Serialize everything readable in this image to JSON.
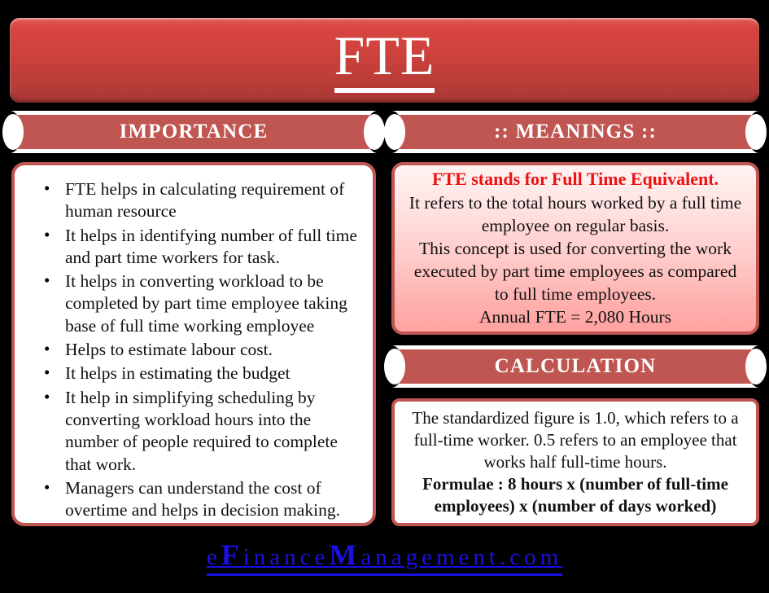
{
  "title": {
    "text": "FTE"
  },
  "sections": {
    "importance": {
      "ribbon_label": "IMPORTANCE",
      "bullets": [
        "FTE helps in calculating requirement of human resource",
        "It helps in identifying number of full time and part time workers for task.",
        "It helps in converting workload to be completed by part time employee taking base of full time working employee",
        "Helps to estimate labour cost.",
        "It helps in estimating the budget",
        "It help in simplifying scheduling by converting workload hours into the number of people required to complete that work.",
        "Managers can understand the cost of overtime and helps in decision making."
      ]
    },
    "meanings": {
      "ribbon_label": ":: MEANINGS ::",
      "heading": "FTE stands for Full Time Equivalent.",
      "lines": [
        "It refers to the total hours worked by a full time employee on regular basis.",
        "This concept is used for converting the work executed by part time employees as compared to full time employees.",
        "Annual FTE = 2,080 Hours"
      ]
    },
    "calculation": {
      "ribbon_label": "CALCULATION",
      "description": "The standardized figure is 1.0, which refers to a full-time worker. 0.5 refers to an employee that works half full-time hours.",
      "formula": "Formulae : 8 hours x (number of full-time employees) x (number of days worked)"
    }
  },
  "footer": {
    "brand_part1": "e",
    "brand_cap1": "F",
    "brand_part2": "inance",
    "brand_cap2": "M",
    "brand_part3": "anagement.com"
  },
  "colors": {
    "background": "#000000",
    "banner_red": "#cd423d",
    "ribbon_red": "#c05652",
    "card_border": "#c05652",
    "heading_red": "#ee1111",
    "footer_blue": "#1a10e0",
    "card_white": "#ffffff",
    "meanings_pink": "#ffa3a1"
  }
}
